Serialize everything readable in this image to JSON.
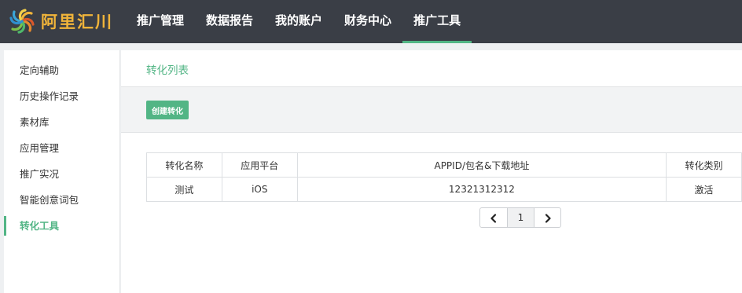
{
  "brand": {
    "logo_text": "阿里汇川",
    "logo_icon": "swirl-logo-icon"
  },
  "nav": {
    "items": [
      {
        "label": "推广管理"
      },
      {
        "label": "数据报告"
      },
      {
        "label": "我的账户"
      },
      {
        "label": "财务中心"
      },
      {
        "label": "推广工具"
      }
    ],
    "active_index": 4
  },
  "sidebar": {
    "items": [
      {
        "label": "定向辅助"
      },
      {
        "label": "历史操作记录"
      },
      {
        "label": "素材库"
      },
      {
        "label": "应用管理"
      },
      {
        "label": "推广实况"
      },
      {
        "label": "智能创意词包"
      },
      {
        "label": "转化工具"
      }
    ],
    "active_index": 6
  },
  "main": {
    "title": "转化列表",
    "create_button": "创建转化",
    "table": {
      "headers": [
        "转化名称",
        "应用平台",
        "APPID/包名&下载地址",
        "转化类别"
      ],
      "rows": [
        [
          "测试",
          "iOS",
          "12321312312",
          "激活"
        ]
      ]
    },
    "pagination": {
      "current_page": "1",
      "prev_icon": "chevron-left-icon",
      "next_icon": "chevron-right-icon"
    }
  },
  "colors": {
    "topbar_bg": "#3a3e46",
    "accent": "#52b585",
    "logo": "#f0b43a"
  }
}
